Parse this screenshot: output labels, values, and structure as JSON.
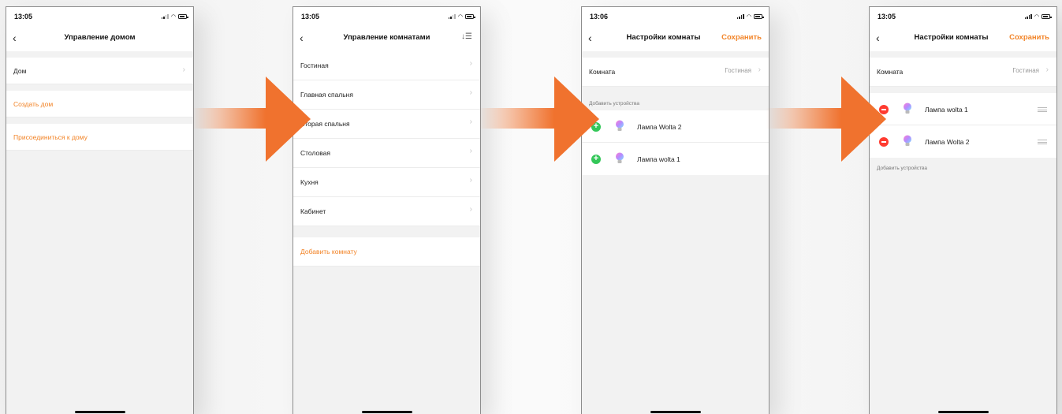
{
  "accent_color": "#f28326",
  "arrow_color": "#f0722e",
  "screens": {
    "home": {
      "time": "13:05",
      "title": "Управление домом",
      "items": [
        {
          "label": "Дом"
        },
        {
          "label": "Создать дом"
        },
        {
          "label": "Присоединиться к дому"
        }
      ]
    },
    "rooms": {
      "time": "13:05",
      "title": "Управление комнатами",
      "sort_icon": "sort-icon",
      "items": [
        {
          "label": "Гостиная"
        },
        {
          "label": "Главная спальня"
        },
        {
          "label": "Вторая спальня"
        },
        {
          "label": "Столовая"
        },
        {
          "label": "Кухня"
        },
        {
          "label": "Кабинет"
        }
      ],
      "add_room": "Добавить комнату"
    },
    "room_settings_1": {
      "time": "13:06",
      "title": "Настройки комнаты",
      "save": "Сохранить",
      "room_label": "Комната",
      "room_value": "Гостиная",
      "section": "Добавить устройства",
      "devices": [
        {
          "name": "Лампа Wolta 2"
        },
        {
          "name": "Лампа wolta 1"
        }
      ]
    },
    "room_settings_2": {
      "time": "13:05",
      "title": "Настройки комнаты",
      "save": "Сохранить",
      "room_label": "Комната",
      "room_value": "Гостиная",
      "devices": [
        {
          "name": "Лампа wolta 1"
        },
        {
          "name": "Лампа Wolta 2"
        }
      ],
      "section": "Добавить устройства"
    }
  }
}
